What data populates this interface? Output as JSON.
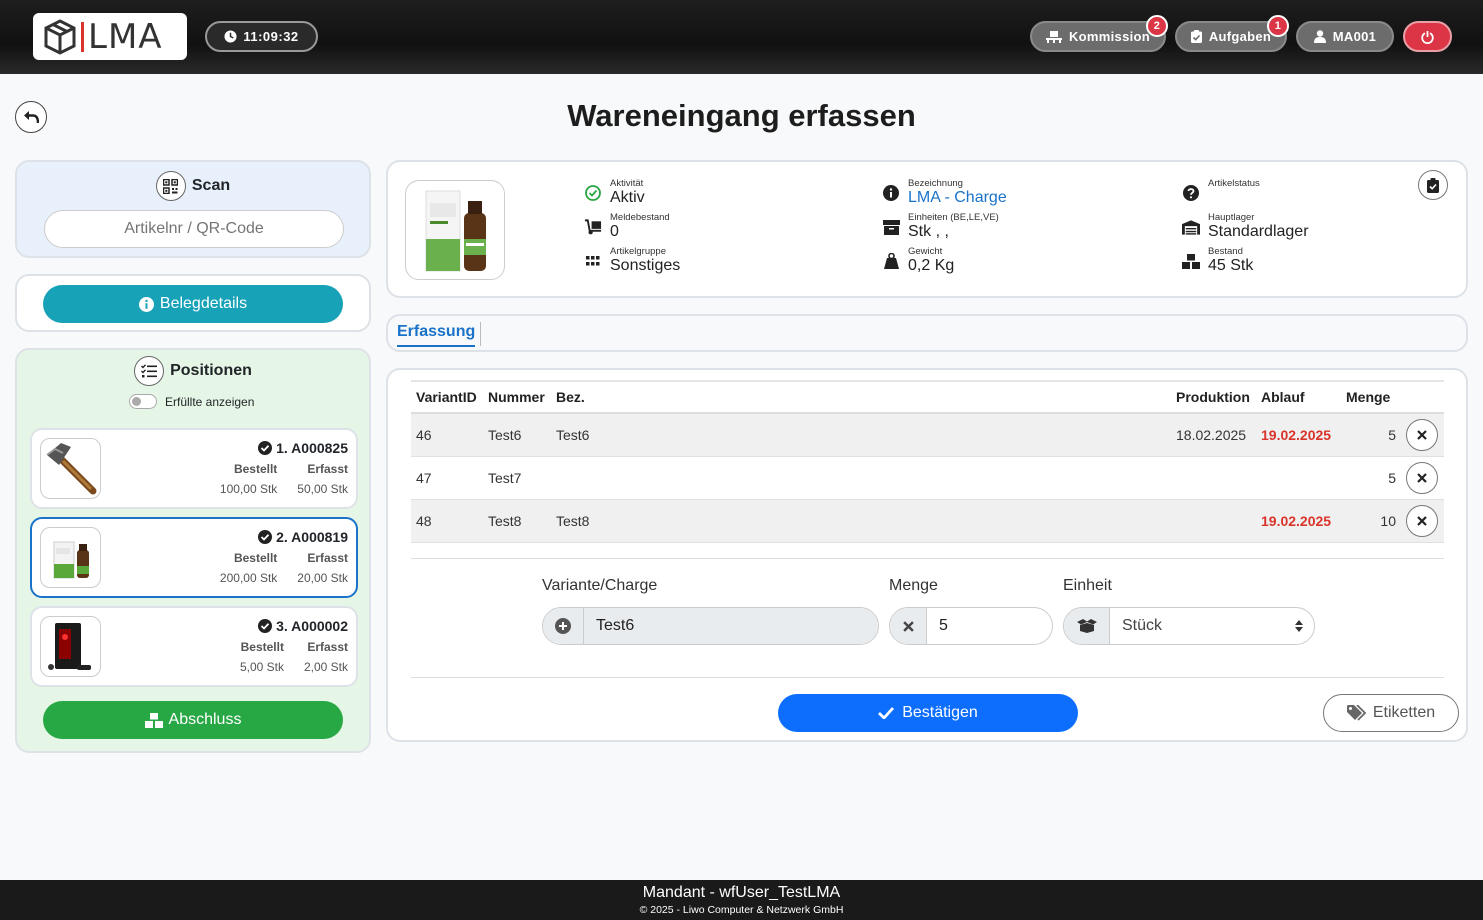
{
  "header": {
    "logo_text": "LMA",
    "clock": "11:09:32",
    "kommission": {
      "label": "Kommission",
      "badge": "2"
    },
    "aufgaben": {
      "label": "Aufgaben",
      "badge": "1"
    },
    "user": "MA001"
  },
  "page": {
    "title": "Wareneingang erfassen"
  },
  "scan": {
    "title": "Scan",
    "placeholder": "Artikelnr / QR-Code"
  },
  "beleg": {
    "label": "Belegdetails"
  },
  "positionen": {
    "title": "Positionen",
    "toggle_label": "Erfüllte anzeigen",
    "items": [
      {
        "title": "1. A000825",
        "bestellt_label": "Bestellt",
        "erfasst_label": "Erfasst",
        "bestellt": "100,00 Stk",
        "erfasst": "50,00 Stk"
      },
      {
        "title": "2. A000819",
        "bestellt_label": "Bestellt",
        "erfasst_label": "Erfasst",
        "bestellt": "200,00 Stk",
        "erfasst": "20,00 Stk"
      },
      {
        "title": "3. A000002",
        "bestellt_label": "Bestellt",
        "erfasst_label": "Erfasst",
        "bestellt": "5,00 Stk",
        "erfasst": "2,00 Stk"
      }
    ],
    "abschluss_label": "Abschluss"
  },
  "article": {
    "aktivitaet": {
      "label": "Aktivität",
      "value": "Aktiv"
    },
    "meldebestand": {
      "label": "Meldebestand",
      "value": "0"
    },
    "artikelgruppe": {
      "label": "Artikelgruppe",
      "value": "Sonstiges"
    },
    "bezeichnung": {
      "label": "Bezeichnung",
      "value": "LMA - Charge"
    },
    "einheiten": {
      "label": "Einheiten (BE,LE,VE)",
      "value": "Stk , ,"
    },
    "gewicht": {
      "label": "Gewicht",
      "value": "0,2 Kg"
    },
    "artikelstatus": {
      "label": "Artikelstatus",
      "value": ""
    },
    "hauptlager": {
      "label": "Hauptlager",
      "value": "Standardlager"
    },
    "bestand": {
      "label": "Bestand",
      "value": "45 Stk"
    }
  },
  "tabs": {
    "erfassung": "Erfassung"
  },
  "table": {
    "headers": {
      "variant": "VariantID",
      "nummer": "Nummer",
      "bez": "Bez.",
      "produktion": "Produktion",
      "ablauf": "Ablauf",
      "menge": "Menge"
    },
    "rows": [
      {
        "variant": "46",
        "nummer": "Test6",
        "bez": "Test6",
        "produktion": "18.02.2025",
        "ablauf": "19.02.2025",
        "menge": "5"
      },
      {
        "variant": "47",
        "nummer": "Test7",
        "bez": "",
        "produktion": "",
        "ablauf": "",
        "menge": "5"
      },
      {
        "variant": "48",
        "nummer": "Test8",
        "bez": "Test8",
        "produktion": "",
        "ablauf": "19.02.2025",
        "menge": "10"
      }
    ]
  },
  "form": {
    "variante_label": "Variante/Charge",
    "variante_value": "Test6",
    "menge_label": "Menge",
    "menge_value": "5",
    "einheit_label": "Einheit",
    "einheit_value": "Stück",
    "confirm_label": "Bestätigen",
    "etiketten_label": "Etiketten"
  },
  "footer": {
    "line1": "Mandant - wfUser_TestLMA",
    "line2": "© 2025 - Liwo Computer & Netzwerk GmbH"
  },
  "colors": {
    "primary": "#0d6efd",
    "info": "#17a2b8",
    "success": "#28a745",
    "danger": "#dc3545",
    "link": "#1a73c9"
  }
}
